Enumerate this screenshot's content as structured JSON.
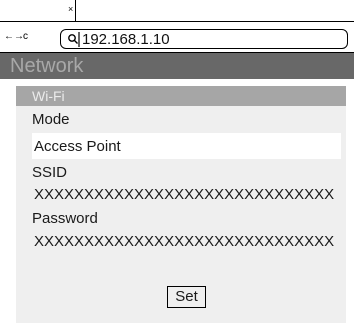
{
  "browser": {
    "tab_close_glyph": "×",
    "nav": {
      "back": "←",
      "forward": "→",
      "reload": "c"
    },
    "address": "192.168.1.10"
  },
  "page": {
    "title": "Network",
    "colors": {
      "header_bg": "#686868",
      "header_text": "#a8a8a8",
      "panel_bg": "#efefef",
      "panel_header_bg": "#a6a6a6"
    }
  },
  "wifi": {
    "section_title": "Wi-Fi",
    "mode_label": "Mode",
    "mode_value": "Access Point",
    "ssid_label": "SSID",
    "ssid_value": "XXXXXXXXXXXXXXXXXXXXXXXXXXXXXX",
    "password_label": "Password",
    "password_value": "XXXXXXXXXXXXXXXXXXXXXXXXXXXXXX",
    "set_label": "Set"
  }
}
